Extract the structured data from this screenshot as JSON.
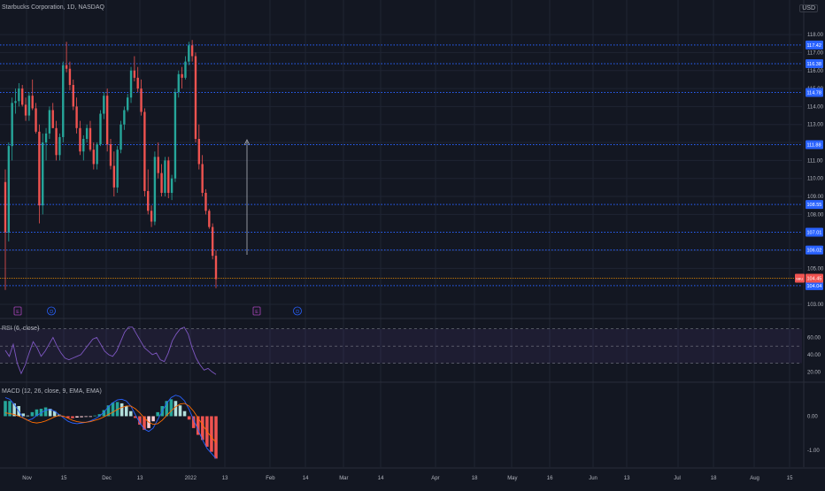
{
  "header": {
    "title": "Starbucks Corporation, 1D, NASDAQ",
    "currency": "USD"
  },
  "colors": {
    "background": "#131722",
    "grid": "#1f2433",
    "up": "#26a69a",
    "down": "#ef5350",
    "level_line": "#2962ff",
    "price_line": "#ff9800",
    "rsi_line": "#7e57c2",
    "macd_line": "#2962ff",
    "signal_line": "#ff6d00",
    "text": "#b2b5be"
  },
  "price_axis": {
    "labels": [
      "118.00",
      "117.00",
      "116.00",
      "115.00",
      "114.00",
      "113.00",
      "112.00",
      "111.00",
      "110.00",
      "109.00",
      "108.00",
      "106.00",
      "105.00",
      "103.00"
    ]
  },
  "level_badges": [
    {
      "label": "117.42",
      "value": 117.42
    },
    {
      "label": "116.38",
      "value": 116.38
    },
    {
      "label": "114.78",
      "value": 114.78
    },
    {
      "label": "111.88",
      "value": 111.88
    },
    {
      "label": "108.55",
      "value": 108.55
    },
    {
      "label": "107.01",
      "value": 107.01
    },
    {
      "label": "106.02",
      "value": 106.02
    },
    {
      "label": "104.04",
      "value": 104.04
    }
  ],
  "last_price": {
    "symbol": "SBUX",
    "label": "104.45",
    "value": 104.45
  },
  "rsi": {
    "label": "RSI (6, close)",
    "axis_labels": [
      "60.00",
      "40.00",
      "20.00"
    ],
    "upper_band": 70,
    "lower_band": 30,
    "values": [
      45,
      38,
      52,
      30,
      18,
      28,
      42,
      55,
      48,
      38,
      44,
      52,
      60,
      50,
      42,
      36,
      34,
      36,
      38,
      40,
      46,
      52,
      58,
      60,
      52,
      44,
      40,
      38,
      44,
      55,
      66,
      72,
      72,
      64,
      56,
      48,
      44,
      40,
      42,
      34,
      32,
      42,
      56,
      64,
      70,
      72,
      64,
      48,
      36,
      28,
      22,
      24,
      20,
      17
    ]
  },
  "macd": {
    "label": "MACD (12, 26, close, 9, EMA, EMA)",
    "axis_labels": [
      "0.00",
      "-1.00"
    ],
    "hist": [
      0.45,
      0.45,
      0.38,
      0.3,
      0.08,
      0.02,
      0.12,
      0.2,
      0.22,
      0.26,
      0.22,
      0.15,
      0.05,
      -0.02,
      -0.05,
      -0.06,
      -0.04,
      -0.03,
      -0.02,
      -0.01,
      0.02,
      0.06,
      0.18,
      0.32,
      0.4,
      0.42,
      0.38,
      0.3,
      0.15,
      -0.05,
      -0.25,
      -0.4,
      -0.35,
      -0.15,
      0.12,
      0.3,
      0.45,
      0.5,
      0.45,
      0.32,
      0.15,
      -0.1,
      -0.35,
      -0.55,
      -0.7,
      -0.9,
      -1.05,
      -1.25
    ],
    "macd_line": [
      0.55,
      0.5,
      0.35,
      0.15,
      -0.05,
      -0.12,
      -0.08,
      0.02,
      0.1,
      0.18,
      0.2,
      0.15,
      0.05,
      -0.05,
      -0.15,
      -0.2,
      -0.22,
      -0.2,
      -0.18,
      -0.14,
      -0.08,
      0.0,
      0.12,
      0.28,
      0.4,
      0.48,
      0.5,
      0.45,
      0.3,
      0.05,
      -0.2,
      -0.38,
      -0.45,
      -0.35,
      -0.1,
      0.15,
      0.38,
      0.55,
      0.62,
      0.58,
      0.45,
      0.2,
      -0.1,
      -0.4,
      -0.7,
      -0.95,
      -1.1,
      -1.25
    ],
    "signal_line": [
      0.1,
      0.08,
      0.05,
      0.0,
      -0.05,
      -0.12,
      -0.18,
      -0.2,
      -0.18,
      -0.14,
      -0.08,
      -0.02,
      0.02,
      0.0,
      -0.06,
      -0.12,
      -0.16,
      -0.18,
      -0.18,
      -0.16,
      -0.12,
      -0.08,
      -0.02,
      0.05,
      0.12,
      0.2,
      0.26,
      0.3,
      0.3,
      0.22,
      0.1,
      -0.05,
      -0.18,
      -0.24,
      -0.22,
      -0.12,
      0.02,
      0.16,
      0.28,
      0.36,
      0.38,
      0.3,
      0.15,
      -0.05,
      -0.25,
      -0.45,
      -0.62,
      -0.78
    ]
  },
  "time_axis": {
    "labels": [
      "Nov",
      "15",
      "Dec",
      "13",
      "2022",
      "13",
      "Feb",
      "14",
      "Mar",
      "14",
      "Apr",
      "18",
      "May",
      "16",
      "Jun",
      "13",
      "Jul",
      "18",
      "Aug",
      "15"
    ]
  },
  "event_markers": [
    {
      "letter": "E",
      "kind": "earnings"
    },
    {
      "letter": "D",
      "kind": "dividend"
    },
    {
      "letter": "E",
      "kind": "earnings"
    },
    {
      "letter": "D",
      "kind": "dividend"
    }
  ],
  "chart_data": {
    "type": "candlestick",
    "title": "Starbucks Corporation, 1D, NASDAQ",
    "y_range": [
      103,
      118.3
    ],
    "ohlc": [
      [
        109.8,
        110.5,
        103.8,
        107.0
      ],
      [
        107.0,
        112.0,
        106.5,
        111.8
      ],
      [
        111.8,
        114.5,
        111.0,
        114.2
      ],
      [
        114.2,
        115.0,
        113.6,
        114.3
      ],
      [
        114.3,
        115.3,
        114.0,
        115.0
      ],
      [
        115.0,
        115.2,
        114.0,
        114.1
      ],
      [
        114.1,
        114.5,
        113.2,
        113.5
      ],
      [
        113.5,
        114.8,
        113.2,
        114.6
      ],
      [
        114.6,
        115.5,
        113.8,
        113.9
      ],
      [
        113.9,
        114.2,
        112.5,
        112.6
      ],
      [
        112.6,
        113.0,
        107.5,
        108.5
      ],
      [
        108.5,
        112.5,
        108.0,
        112.0
      ],
      [
        112.0,
        112.8,
        111.0,
        112.5
      ],
      [
        112.5,
        114.0,
        112.2,
        113.8
      ],
      [
        113.8,
        114.2,
        112.8,
        112.8
      ],
      [
        112.8,
        113.2,
        111.0,
        111.3
      ],
      [
        111.3,
        112.5,
        111.0,
        112.3
      ],
      [
        112.3,
        116.5,
        112.0,
        116.3
      ],
      [
        116.3,
        117.6,
        115.9,
        116.1
      ],
      [
        116.1,
        116.5,
        114.9,
        115.2
      ],
      [
        115.2,
        115.5,
        113.8,
        114.0
      ],
      [
        114.0,
        114.5,
        112.5,
        112.8
      ],
      [
        112.8,
        113.2,
        111.3,
        111.5
      ],
      [
        111.5,
        112.4,
        111.0,
        112.2
      ],
      [
        112.2,
        113.0,
        112.0,
        112.8
      ],
      [
        112.8,
        113.2,
        111.5,
        111.6
      ],
      [
        111.6,
        112.0,
        110.5,
        110.8
      ],
      [
        110.8,
        112.0,
        110.5,
        111.9
      ],
      [
        111.9,
        113.8,
        111.8,
        113.6
      ],
      [
        113.6,
        114.8,
        113.3,
        114.6
      ],
      [
        114.6,
        115.0,
        111.5,
        111.9
      ],
      [
        111.9,
        112.2,
        110.5,
        110.7
      ],
      [
        110.7,
        111.5,
        109.0,
        109.5
      ],
      [
        109.5,
        111.8,
        109.2,
        111.6
      ],
      [
        111.6,
        113.2,
        111.4,
        113.0
      ],
      [
        113.0,
        114.0,
        112.7,
        113.8
      ],
      [
        113.8,
        114.7,
        113.7,
        114.5
      ],
      [
        114.5,
        116.2,
        114.2,
        116.0
      ],
      [
        116.0,
        116.8,
        115.4,
        115.6
      ],
      [
        115.6,
        116.2,
        114.8,
        115.0
      ],
      [
        115.0,
        115.5,
        113.5,
        113.7
      ],
      [
        113.7,
        113.9,
        109.0,
        109.3
      ],
      [
        109.3,
        110.5,
        108.0,
        108.2
      ],
      [
        108.2,
        108.5,
        107.3,
        107.6
      ],
      [
        107.6,
        111.5,
        107.4,
        111.2
      ],
      [
        111.2,
        112.0,
        110.0,
        110.3
      ],
      [
        110.3,
        110.8,
        109.0,
        109.2
      ],
      [
        109.2,
        111.2,
        109.0,
        111.0
      ],
      [
        111.0,
        111.2,
        108.9,
        109.2
      ],
      [
        109.2,
        110.2,
        108.8,
        110.0
      ],
      [
        110.0,
        115.0,
        109.8,
        114.8
      ],
      [
        114.8,
        116.0,
        114.5,
        115.8
      ],
      [
        115.8,
        116.2,
        115.0,
        115.6
      ],
      [
        115.6,
        116.8,
        115.5,
        116.5
      ],
      [
        116.5,
        117.6,
        116.3,
        117.4
      ],
      [
        117.4,
        117.7,
        116.5,
        116.8
      ],
      [
        116.8,
        117.0,
        112.0,
        112.2
      ],
      [
        112.2,
        113.0,
        110.5,
        110.8
      ],
      [
        110.8,
        111.3,
        109.0,
        109.2
      ],
      [
        109.2,
        109.4,
        108.0,
        108.2
      ],
      [
        108.2,
        108.3,
        107.2,
        107.3
      ],
      [
        107.3,
        107.5,
        105.5,
        105.7
      ],
      [
        105.7,
        106.0,
        103.9,
        104.4
      ]
    ],
    "horizontal_levels": [
      117.42,
      116.38,
      114.78,
      111.88,
      108.55,
      107.01,
      106.02,
      104.04
    ],
    "last_price": 104.45,
    "indicators": [
      "RSI (6, close)",
      "MACD (12, 26, close, 9, EMA, EMA)"
    ]
  }
}
